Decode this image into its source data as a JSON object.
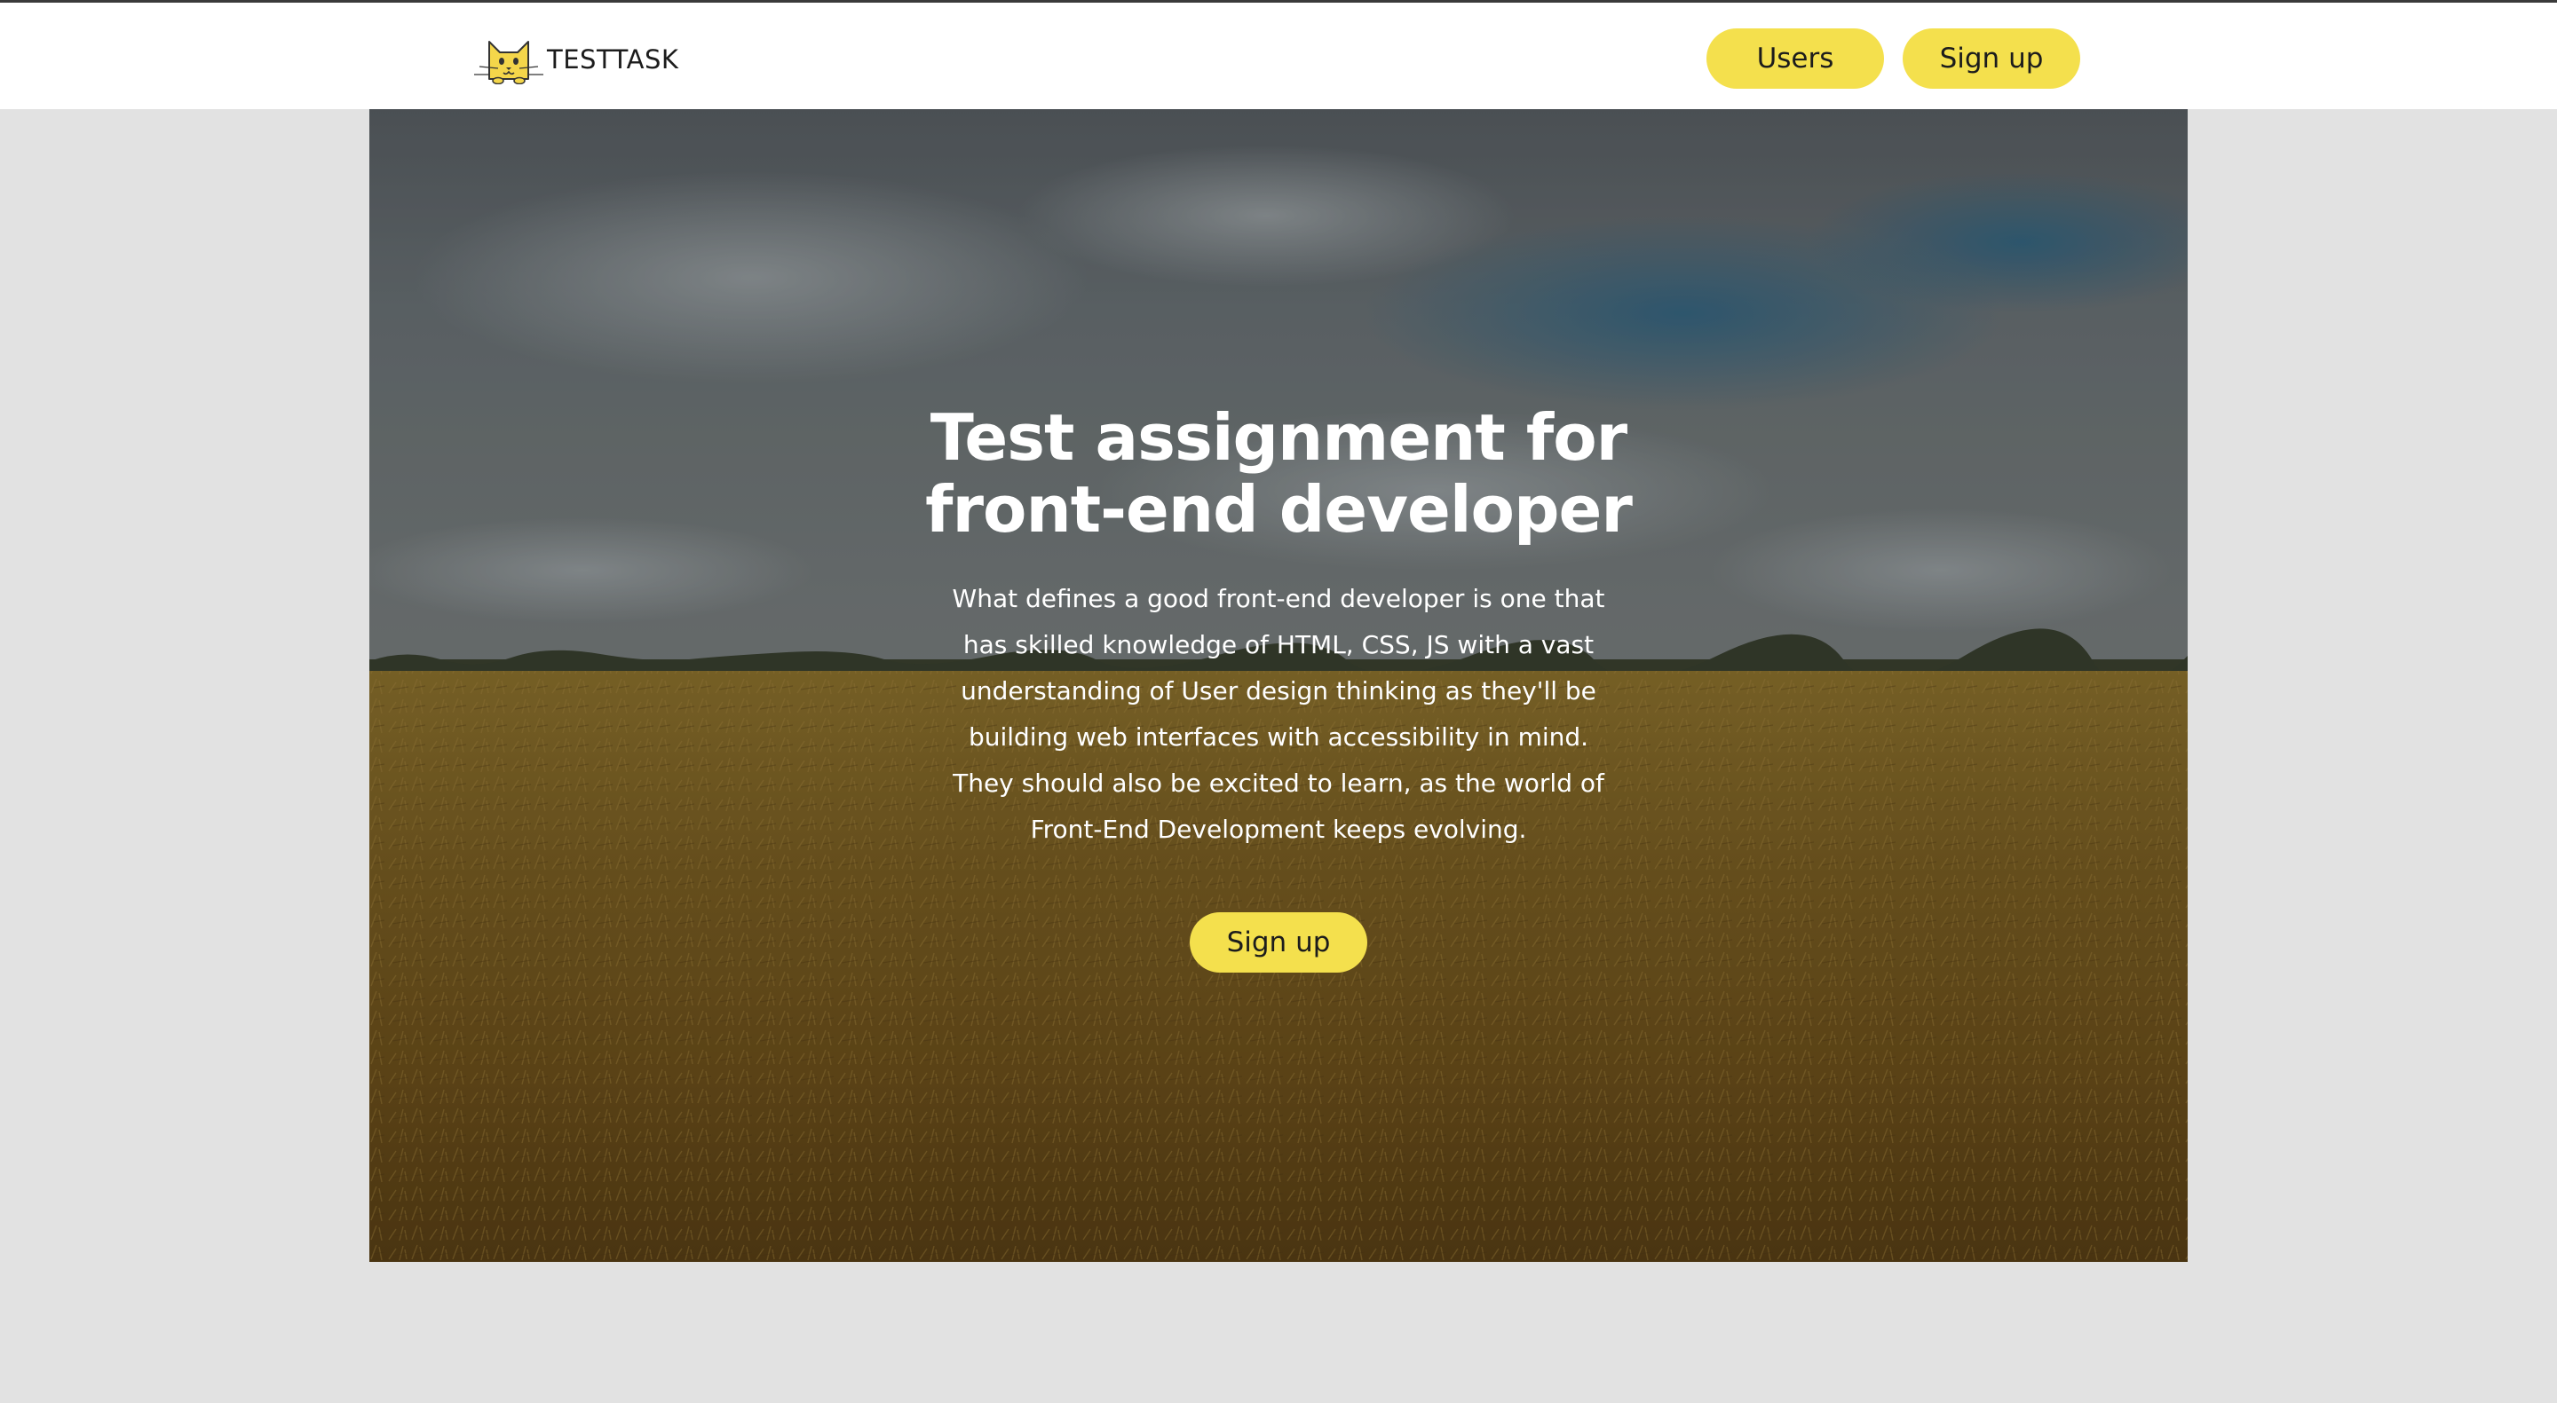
{
  "header": {
    "logo_text": "TESTTASK",
    "logo_icon": "cat-icon",
    "nav": {
      "users_label": "Users",
      "signup_label": "Sign up"
    }
  },
  "hero": {
    "title_line1": "Test assignment for",
    "title_line2": "front-end developer",
    "text_lines": [
      "What defines a good front-end developer is one that",
      "has skilled knowledge of HTML, CSS, JS with a vast",
      "understanding of User design thinking as they'll be",
      "building web interfaces with accessibility in mind.",
      "They should also be excited to learn, as the world of",
      "Front-End Development keeps evolving."
    ],
    "cta_label": "Sign up",
    "background": "wheat-field-photo"
  },
  "colors": {
    "accent": "#f4e04d",
    "page_bg": "#e2e2e2",
    "header_bg": "#ffffff",
    "text_dark": "#1c1c1c",
    "hero_text": "#ffffff"
  }
}
